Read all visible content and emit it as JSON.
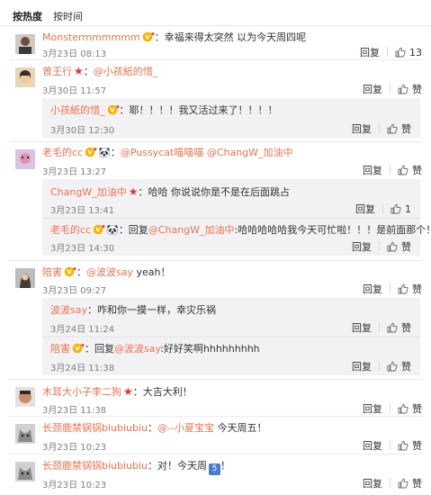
{
  "tabs": {
    "hot": "按热度",
    "time": "按时间"
  },
  "labels": {
    "reply": "回复",
    "like": "赞"
  },
  "colors": {
    "accent": "#eb7350",
    "reply_bg": "#f2f2f5",
    "star": "#e5322d"
  },
  "comments": [
    {
      "user": "Monstermmmmmm",
      "sep": "：",
      "text": "幸福来得太突然 以为今天周四呢",
      "time": "3月23日 08:13",
      "likes": "13"
    },
    {
      "user": "曾王行",
      "sep": "：",
      "mention": "@小孩紙的惜_",
      "text": "",
      "time": "3月30日 11:57",
      "likes": "赞",
      "replies": [
        {
          "user": "小孩紙的惜_",
          "text": "：耶！！！！我又活过来了！！！！",
          "time": "3月30日 12:30",
          "likes": "赞"
        }
      ]
    },
    {
      "user": "老毛的cc",
      "sep": "：",
      "mention": "@Pussycat喵喵喵",
      "mention2": "@ChangW_加油中",
      "text": "",
      "time": "3月23日 13:27",
      "likes": "赞",
      "replies": [
        {
          "user": "ChangW_加油中",
          "text": "：哈哈 你说说你是不是在后面跳占",
          "time": "3月23日 13:41",
          "likes": "1"
        },
        {
          "user": "老毛的cc",
          "prefix": "：回复",
          "mention": "@ChangW_加油中",
          "text": ":哈哈哈哈哈我今天可忙啦！！！是前面那个！",
          "time": "3月23日 14:30",
          "likes": "赞"
        }
      ]
    },
    {
      "user": "陪害",
      "sep": "：",
      "mention": "@波波say",
      "text": " yeah！",
      "time": "3月23日 09:27",
      "likes": "赞",
      "replies": [
        {
          "user": "波波say",
          "text": "：咋和你一摸一样，幸灾乐祸",
          "time": "3月24日 11:24",
          "likes": "赞"
        },
        {
          "user": "陪害",
          "prefix": "：回复",
          "mention": "@波波say",
          "text": ":好好笑啊hhhhhhhhh",
          "time": "3月24日 11:38",
          "likes": "赞"
        }
      ]
    },
    {
      "user": "木耳大小子李二狗",
      "sep": "：",
      "text": "大吉大利！",
      "time": "3月23日 11:38",
      "likes": "赞"
    },
    {
      "user": "长颈鹿禁锅锅biubiubiu",
      "sep": "：",
      "mention": "@--小夏宝宝",
      "text": " 今天周五！",
      "time": "3月23日 10:23",
      "likes": "赞"
    },
    {
      "user": "长颈鹿禁锅锅biubiubiu",
      "sep": "：",
      "text": "对！今天周",
      "emoji_text": "5",
      "text2": "！",
      "time": "3月23日 10:23",
      "likes": "赞"
    }
  ]
}
